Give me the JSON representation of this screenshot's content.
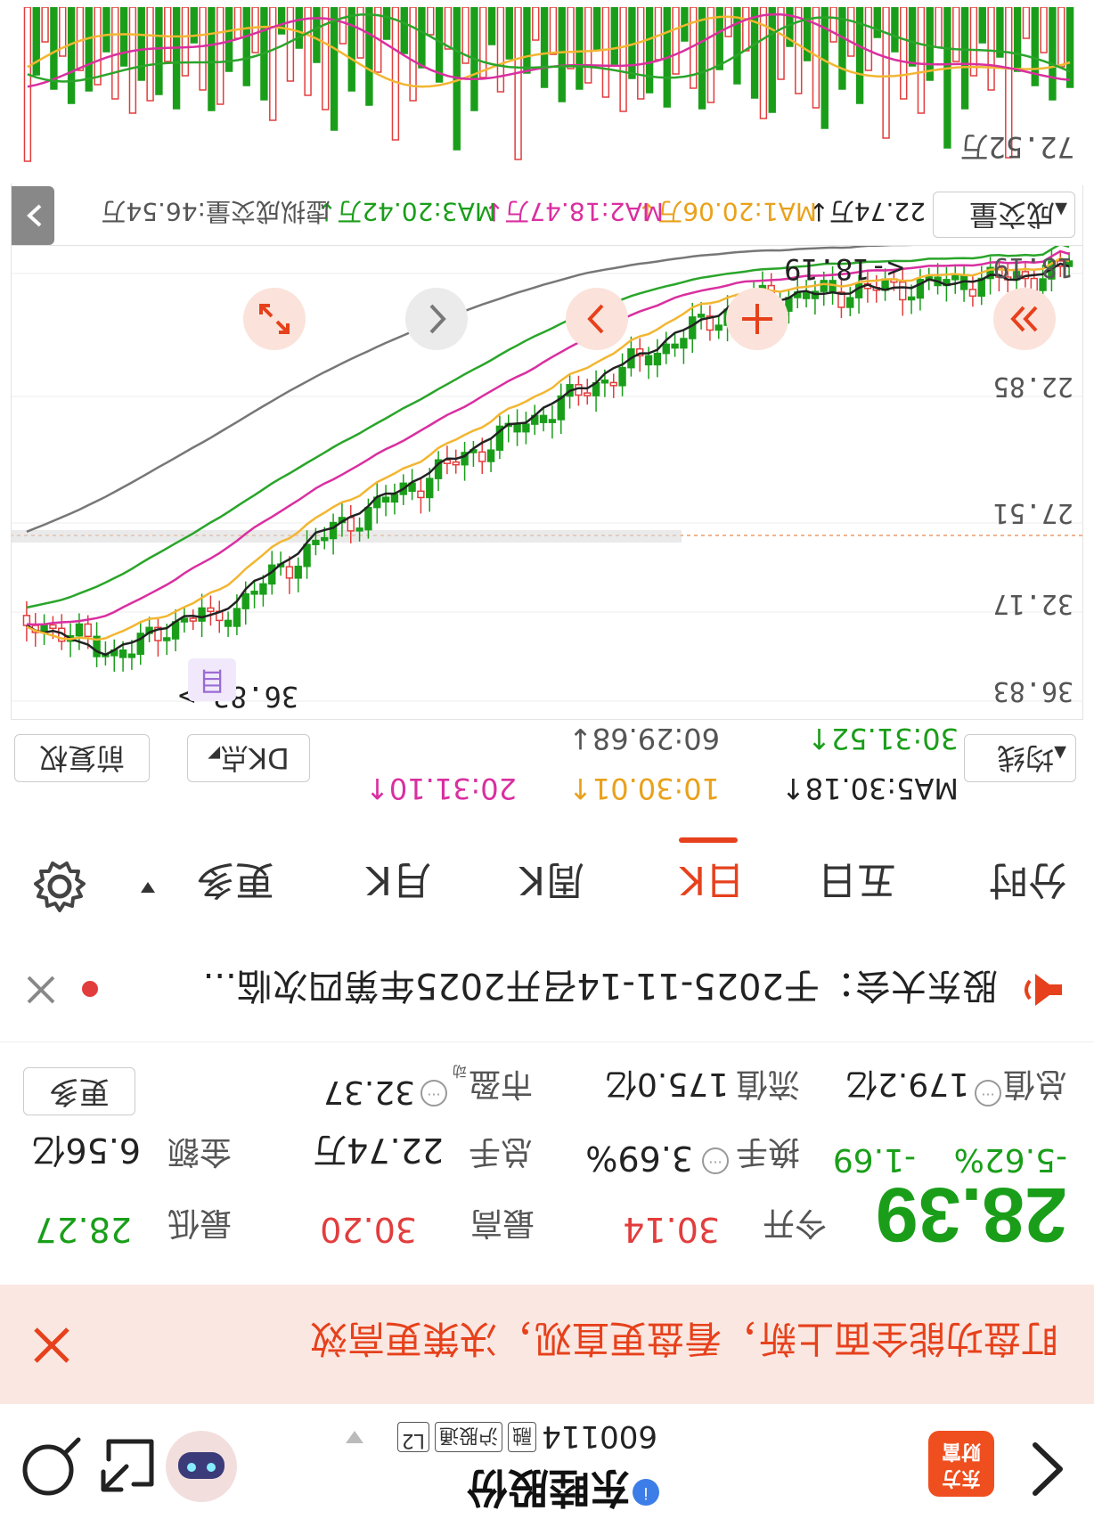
{
  "header": {
    "stock_name": "东睦股份",
    "stock_code": "600114",
    "tags": [
      "融",
      "沪股通",
      "L2"
    ],
    "logo_text": [
      "东方",
      "财富"
    ]
  },
  "promo": {
    "text": "盯盘功能全面上新，看盘更直观，决策更高效"
  },
  "quote": {
    "price": "28.39",
    "change_pct": "-5.62%",
    "change": "-1.69",
    "open_label": "今开",
    "open": "30.14",
    "high_label": "最高",
    "high": "30.20",
    "low_label": "最低",
    "low": "28.27",
    "turnover_label": "换手",
    "turnover": "3.69%",
    "volume_label": "总手",
    "volume": "22.74万",
    "amount_label": "金额",
    "amount": "6.56亿",
    "total_mv_label": "总值",
    "total_mv": "179.2亿",
    "float_mv_label": "流值",
    "float_mv": "175.0亿",
    "pe_label": "市盈",
    "pe_sup": "动",
    "pe": "32.37",
    "more": "更多"
  },
  "news": {
    "text": "股东大会：于2025-11-14召开2025年第四次临..."
  },
  "tabs": [
    "分时",
    "五日",
    "日K",
    "周K",
    "月K",
    "更多"
  ],
  "active_tab": "日K",
  "toolbar": {
    "ma_selector": "均线",
    "ma5": "MA5:30.18↑",
    "ma10": "10:30.01↑",
    "ma20": "20:31.10↑",
    "ma30": "30:31.52↑",
    "ma60": "60:29.68↓",
    "dk_btn": "DK点",
    "fq_btn": "前复权"
  },
  "kline": {
    "price_labels": [
      "36.83",
      "32.17",
      "27.51",
      "22.85",
      "18.19"
    ],
    "high_marker": "36.83->",
    "low_marker": "<-18.19",
    "event_badge": "目",
    "colors": {
      "up": "#e23d3d",
      "down": "#1a9e1a",
      "ma5": "#222222",
      "ma10": "#f2b632",
      "ma20": "#d92fa0",
      "ma30": "#2aa52a",
      "ma60": "#777777"
    }
  },
  "volume": {
    "selector": "成交量",
    "vol": "22.74万↓",
    "ma1": "MA1:20.06万↓",
    "ma2": "MA2:18.47万↓",
    "ma3": "MA3:20.42万↓",
    "virtual": "虚拟成交量:46.54万",
    "max_label": "72.52万"
  }
}
